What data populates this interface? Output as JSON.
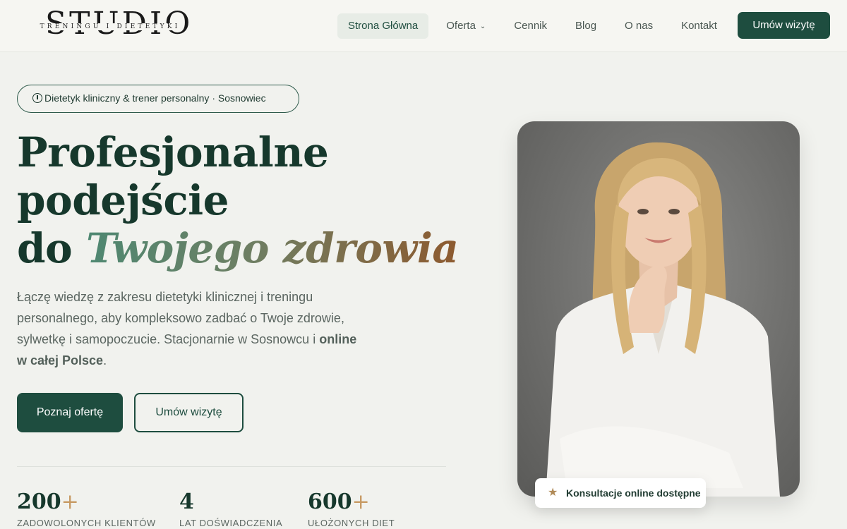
{
  "header": {
    "logo_big": "STUDIO",
    "logo_small": "TRENINGU I DIETETYKI",
    "nav": [
      {
        "label": "Strona Główna"
      },
      {
        "label": "Oferta"
      },
      {
        "label": "Cennik"
      },
      {
        "label": "Blog"
      },
      {
        "label": "O nas"
      },
      {
        "label": "Kontakt"
      }
    ],
    "cta": "Umów wizytę"
  },
  "hero": {
    "badge": "Dietetyk kliniczny & trener personalny · Sosnowiec",
    "headline_line1": "Profesjonalne",
    "headline_line2": "podejście",
    "headline_line3_prefix": "do ",
    "headline_line3_accent": "Twojego zdrowia",
    "lead_text": "Łączę wiedzę z zakresu dietetyki klinicznej i treningu personalnego, aby kompleksowo zadbać o Twoje zdrowie, sylwetkę i samopoczucie. Stacjonarnie w Sosnowcu i ",
    "lead_bold": "online w całej Polsce",
    "lead_end": ".",
    "btn_primary": "Poznaj ofertę",
    "btn_secondary": "Umów wizytę"
  },
  "stats": [
    {
      "value": "200",
      "suffix": "+",
      "label": "ZADOWOLONYCH KLIENTÓW"
    },
    {
      "value": "4",
      "suffix": "",
      "label": "LAT DOŚWIADCZENIA"
    },
    {
      "value": "600",
      "suffix": "+",
      "label": "UŁOŻONYCH DIET"
    }
  ],
  "photo_badge": "Konsultacje online dostępne",
  "colors": {
    "brand_green": "#1e4d3f",
    "heading": "#16382c",
    "accent_gold": "#c79a63",
    "background": "#f1f2ee"
  }
}
